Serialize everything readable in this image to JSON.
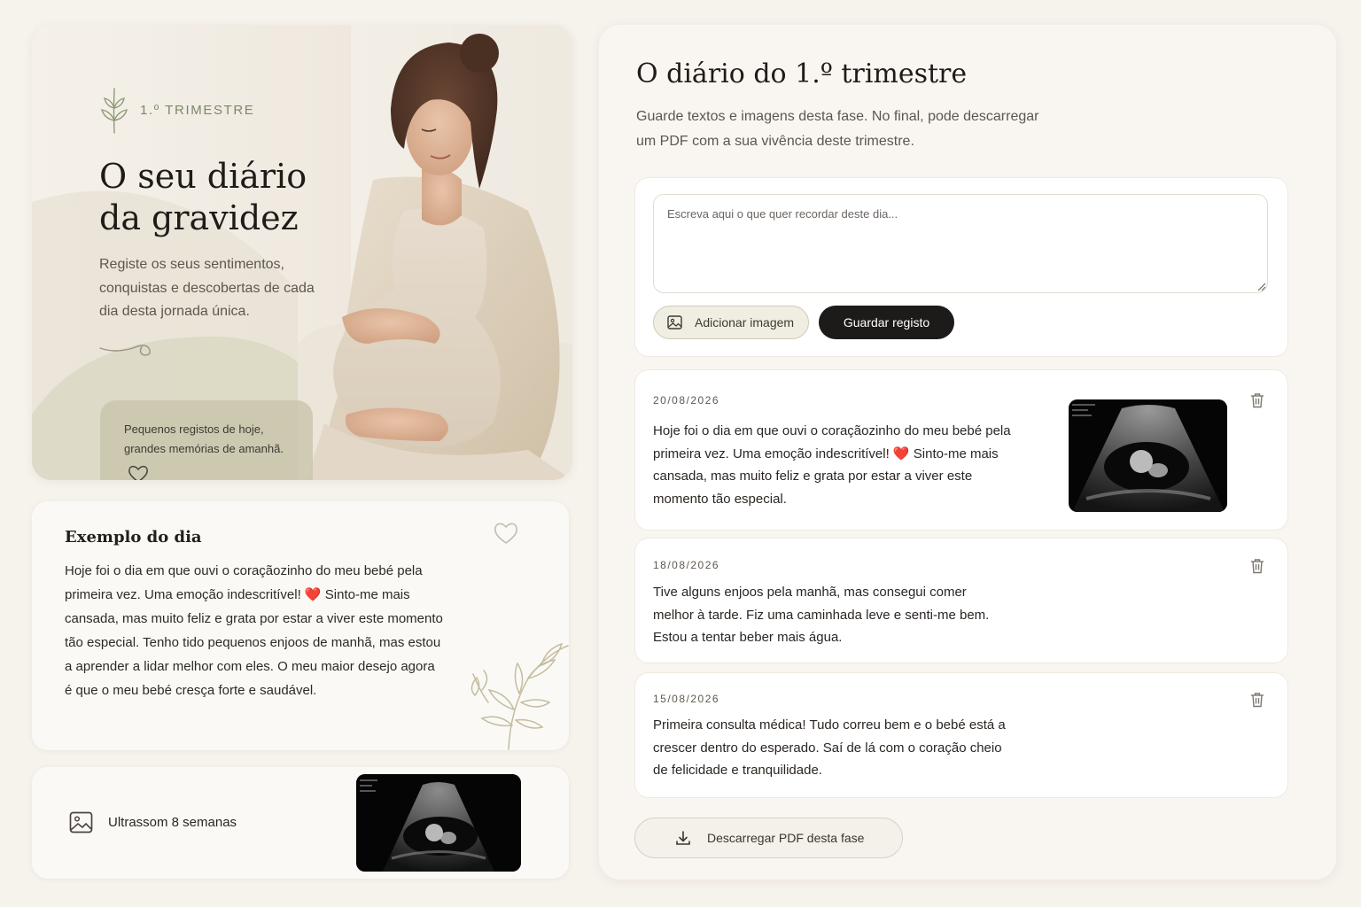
{
  "hero": {
    "badge": "1.º TRIMESTRE",
    "title_line1": "O seu diário",
    "title_line2": "da gravidez",
    "subtitle": "Registe os seus sentimentos, conquistas e descobertas de cada dia desta jornada única.",
    "quote_line1": "Pequenos registos de hoje,",
    "quote_line2": "grandes memórias de amanhã."
  },
  "example": {
    "title": "Exemplo do dia",
    "text": "Hoje foi o dia em que ouvi o coraçãozinho do meu bebé pela primeira vez. Uma emoção indescritível! ❤️ Sinto-me mais cansada, mas muito feliz e grata por estar a viver este momento tão especial. Tenho tido pequenos enjoos de manhã, mas estou a aprender a lidar melhor com eles. O meu maior desejo agora é que o meu bebé cresça forte e saudável."
  },
  "ultrasound_card": {
    "label": "Ultrassom 8 semanas"
  },
  "panel": {
    "title": "O diário do 1.º trimestre",
    "subtitle_line1": "Guarde textos e imagens desta fase. No final, pode descarregar",
    "subtitle_line2": "um PDF com a sua vivência deste trimestre."
  },
  "composer": {
    "placeholder": "Escreva aqui o que quer recordar deste dia...",
    "add_image_label": "Adicionar imagem",
    "save_label": "Guardar registo"
  },
  "entries": [
    {
      "date": "20/08/2026",
      "text": "Hoje foi o dia em que ouvi o coraçãozinho do meu bebé pela primeira vez. Uma emoção indescritível! ❤️ Sinto-me mais cansada, mas muito feliz e grata por estar a viver este momento tão especial.",
      "has_image": true
    },
    {
      "date": "18/08/2026",
      "text": "Tive alguns enjoos pela manhã, mas consegui comer melhor à tarde. Fiz uma caminhada leve e senti-me bem. Estou a tentar beber mais água.",
      "has_image": false
    },
    {
      "date": "15/08/2026",
      "text": "Primeira consulta médica! Tudo correu bem e o bebé está a crescer dentro do esperado. Saí de lá com o coração cheio de felicidade e tranquilidade.",
      "has_image": false
    }
  ],
  "download": {
    "label": "Descarregar PDF desta fase"
  },
  "icons": {
    "leaf": "leaf-icon",
    "heart": "heart-icon",
    "image": "image-icon",
    "trash": "trash-icon",
    "download": "download-icon"
  },
  "colors": {
    "background": "#f6f2ec",
    "accent_green": "#7d8867",
    "primary_button": "#1d1b1a",
    "heart_red": "#d0222c"
  }
}
